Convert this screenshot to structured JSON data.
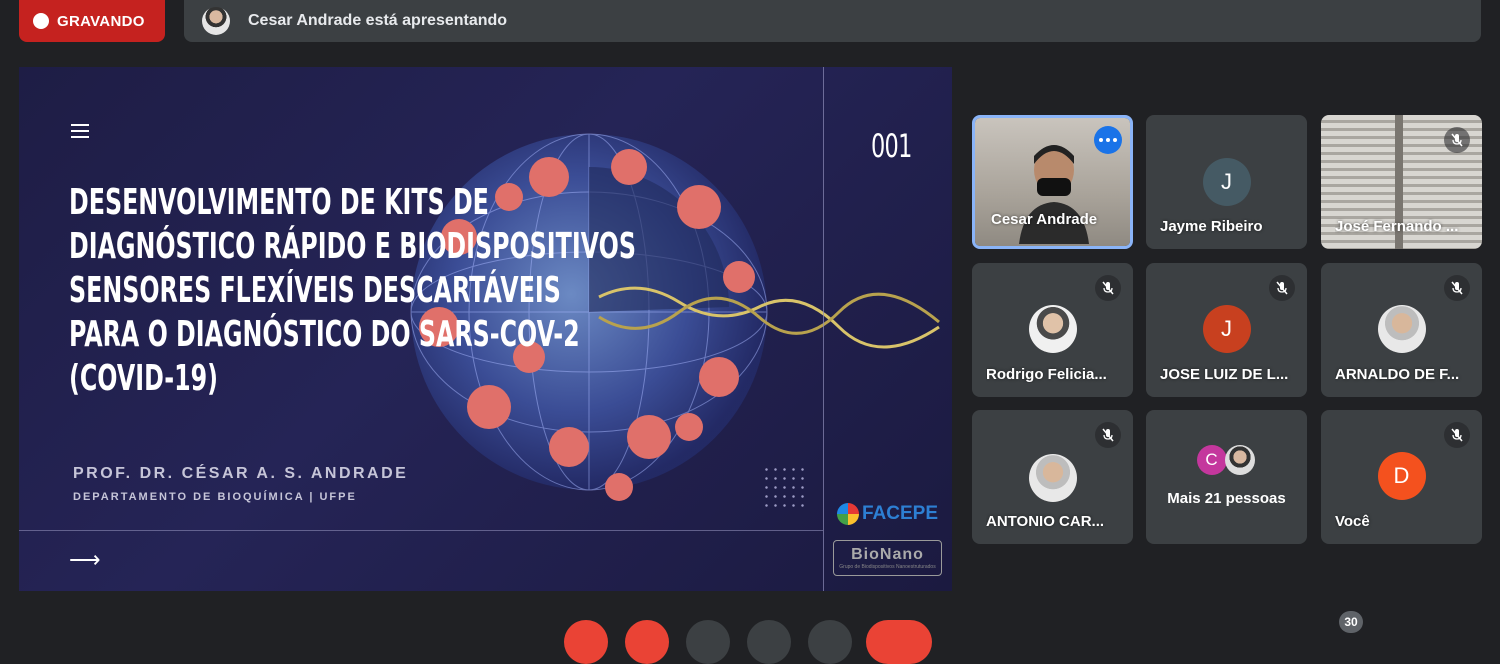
{
  "recording": {
    "label": "GRAVANDO",
    "color": "#c5221f"
  },
  "presenting": {
    "text": "Cesar Andrade está apresentando"
  },
  "slide": {
    "title": "DESENVOLVIMENTO DE KITS DE\nDIAGNÓSTICO RÁPIDO E BIODISPOSITIVOS\nSENSORES FLEXÍVEIS DESCARTÁVEIS\nPARA O DIAGNÓSTICO DO SARS-CoV-2\n(COVID-19)",
    "author": "PROF. DR. CÉSAR A. S. ANDRADE",
    "department": "DEPARTAMENTO DE BIOQUÍMICA | UFPE",
    "number": "001",
    "logo_facepe": "FACEPE",
    "logo_bionano": "BioNano",
    "logo_bionano_sub": "Grupo de Biodispositivos Nanoestruturados"
  },
  "participants": [
    {
      "name": "Cesar Andrade",
      "type": "video",
      "active": true
    },
    {
      "name": "Jayme Ribeiro",
      "type": "initial",
      "initial": "J",
      "color": "#455a64"
    },
    {
      "name": "José Fernando ...",
      "type": "video-shutter",
      "muted": true
    },
    {
      "name": "Rodrigo Felicia...",
      "type": "photo",
      "muted": true
    },
    {
      "name": "JOSE LUIZ DE L...",
      "type": "initial",
      "initial": "J",
      "color": "#c8401f",
      "muted": true
    },
    {
      "name": "ARNALDO DE F...",
      "type": "photo",
      "muted": true
    },
    {
      "name": "ANTONIO CAR...",
      "type": "photo",
      "muted": true
    },
    {
      "name": "Mais 21 pessoas",
      "type": "group",
      "initial": "C",
      "color": "#c4379d"
    },
    {
      "name": "Você",
      "type": "initial",
      "initial": "D",
      "color": "#f4511e",
      "muted": true
    }
  ],
  "participant_count": "30",
  "icons": {
    "mic_off": "mic-off-icon",
    "more": "more-options-icon",
    "menu": "hamburger-menu-icon",
    "arrow": "arrow-right-icon"
  }
}
